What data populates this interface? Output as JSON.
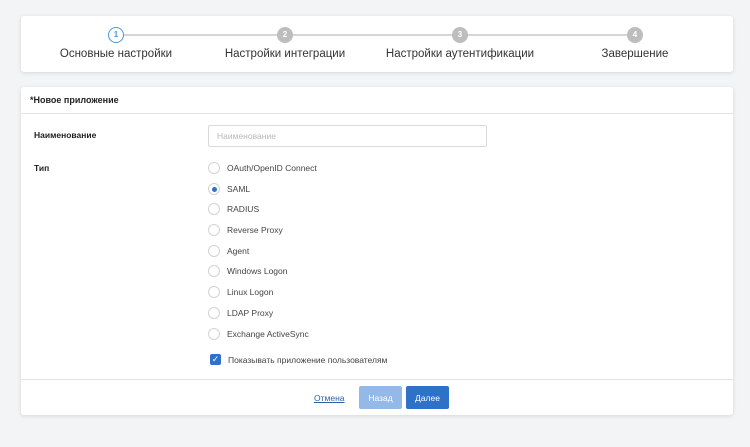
{
  "stepper": {
    "steps": [
      {
        "number": "1",
        "label": "Основные настройки",
        "state": "active"
      },
      {
        "number": "2",
        "label": "Настройки интеграции",
        "state": "inactive"
      },
      {
        "number": "3",
        "label": "Настройки аутентификации",
        "state": "inactive"
      },
      {
        "number": "4",
        "label": "Завершение",
        "state": "inactive"
      }
    ]
  },
  "form": {
    "header": "*Новое приложение",
    "name_label": "Наименование",
    "name_placeholder": "Наименование",
    "name_value": "",
    "type_label": "Тип",
    "types": [
      {
        "label": "OAuth/OpenID Connect",
        "checked": false
      },
      {
        "label": "SAML",
        "checked": true
      },
      {
        "label": "RADIUS",
        "checked": false
      },
      {
        "label": "Reverse Proxy",
        "checked": false
      },
      {
        "label": "Agent",
        "checked": false
      },
      {
        "label": "Windows Logon",
        "checked": false
      },
      {
        "label": "Linux Logon",
        "checked": false
      },
      {
        "label": "LDAP Proxy",
        "checked": false
      },
      {
        "label": "Exchange ActiveSync",
        "checked": false
      }
    ],
    "show_to_users_label": "Показывать приложение пользователям",
    "show_to_users_checked": true
  },
  "footer": {
    "cancel_label": "Отмена",
    "back_label": "Назад",
    "next_label": "Далее"
  },
  "colors": {
    "primary": "#2d72c8",
    "primary_disabled": "#93b9e8",
    "step_active": "#4a98d6",
    "step_inactive": "#bdbdbd"
  }
}
